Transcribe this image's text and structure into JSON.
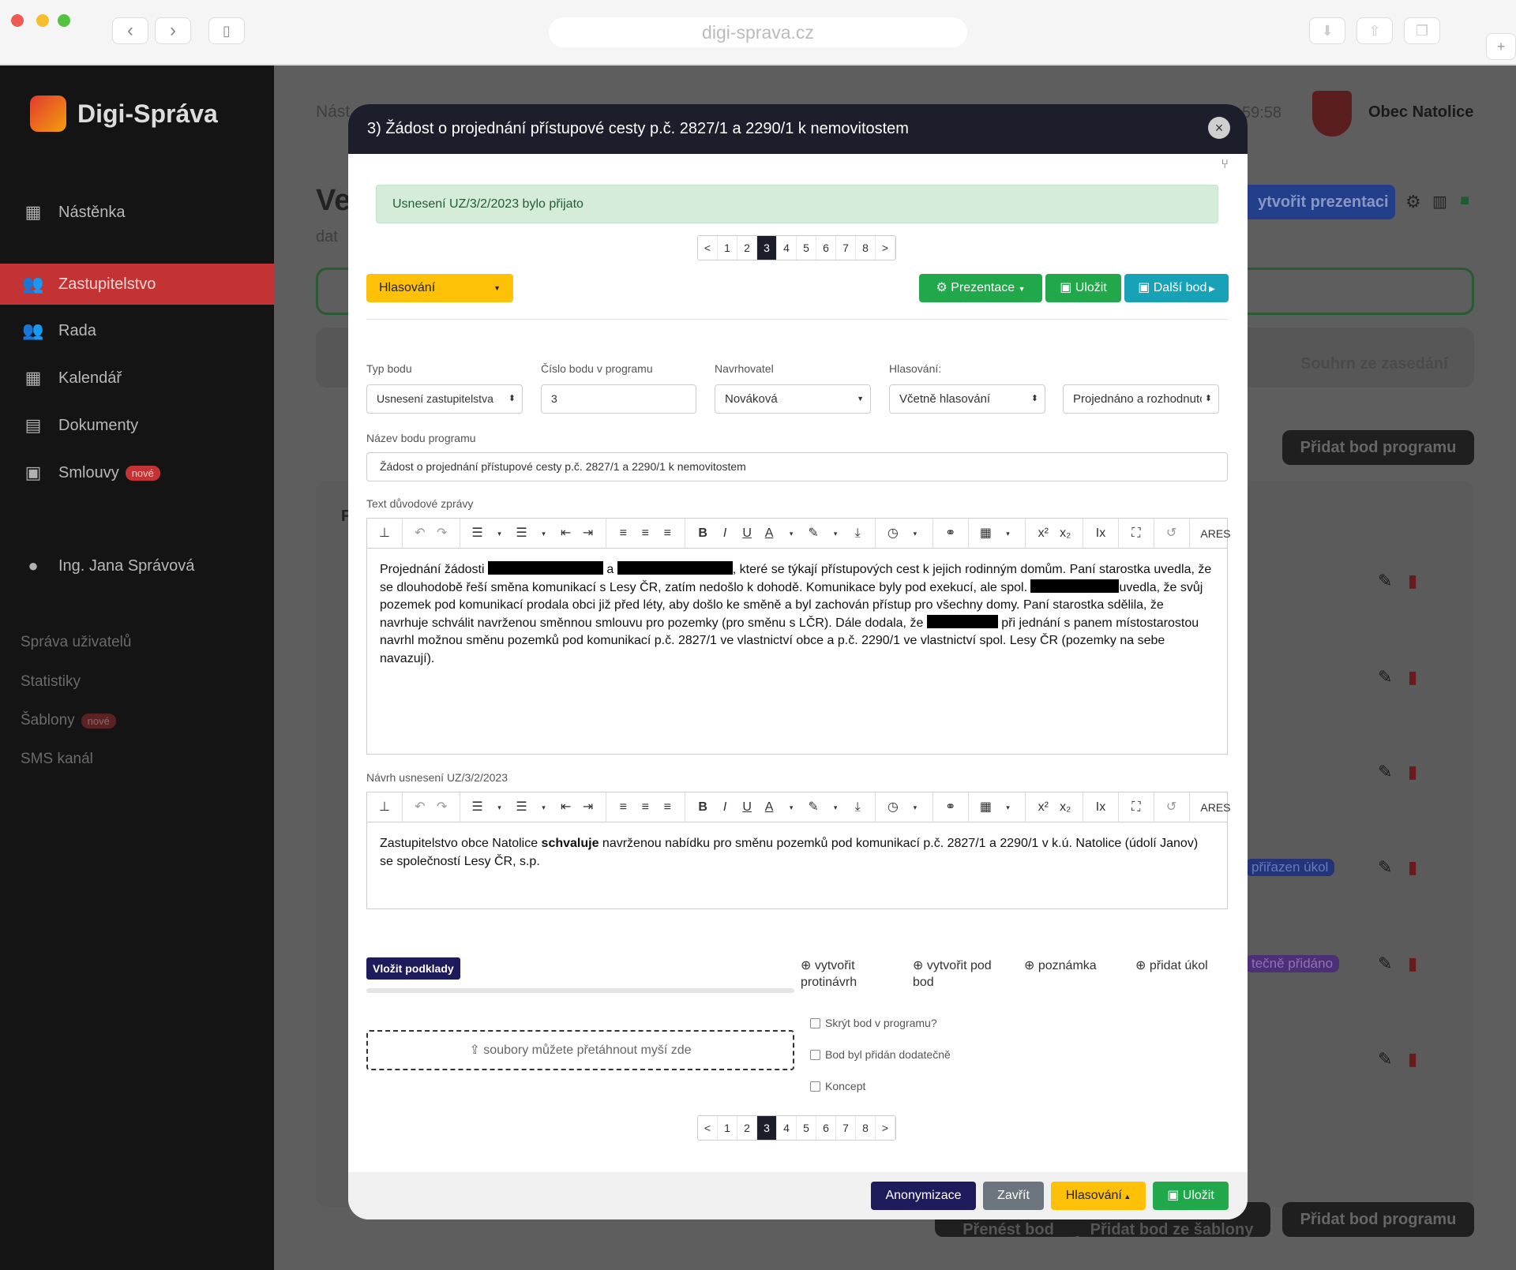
{
  "browser": {
    "url": "digi-sprava.cz"
  },
  "sidebar": {
    "logo": "Digi-Správa",
    "items": [
      {
        "label": "Nástěnka",
        "icon": "dashboard-icon"
      },
      {
        "label": "Zastupitelstvo",
        "icon": "users-icon"
      },
      {
        "label": "Rada",
        "icon": "users-icon"
      },
      {
        "label": "Kalendář",
        "icon": "calendar-icon"
      },
      {
        "label": "Dokumenty",
        "icon": "clipboard-icon"
      },
      {
        "label": "Smlouvy",
        "icon": "briefcase-icon",
        "badge": "nové"
      }
    ],
    "user": "Ing. Jana Správová",
    "admin": [
      {
        "label": "Správa uživatelů"
      },
      {
        "label": "Statistiky"
      },
      {
        "label": "Šablony",
        "badge": "nové"
      },
      {
        "label": "SMS kanál"
      }
    ]
  },
  "background": {
    "breadcrumb": "Nást",
    "time": "59:58",
    "municipality": "Obec Natolice",
    "heading": "Ve",
    "sub": "dat",
    "create_presentation": "ytvořit prezentaci",
    "summary_tab": "Souhrn ze zasedání",
    "add_item": "Přidat bod programu",
    "add_item_bottom": "Přidat bod programu",
    "move_item": "Přenést bod",
    "add_from_template": "Přidat bod ze šablony",
    "f_letter": "F",
    "tag_task": "přiřazen úkol",
    "tag_added": "tečně přidáno"
  },
  "modal": {
    "title": "3) Žádost o projednání přístupové cesty p.č. 2827/1 a 2290/1 k nemovitostem",
    "alert": "Usnesení UZ/3/2/2023 bylo přijato",
    "pager": [
      "<",
      "1",
      "2",
      "3",
      "4",
      "5",
      "6",
      "7",
      "8",
      ">"
    ],
    "pager_selected": "3",
    "voting_dropdown": "Hlasování",
    "btn_presentation": "Prezentace",
    "btn_save": "Uložit",
    "btn_next": "Další bod",
    "labels": {
      "type": "Typ bodu",
      "number": "Číslo bodu v programu",
      "proposer": "Navrhovatel",
      "voting": "Hlasování:",
      "name": "Název bodu programu",
      "reason": "Text důvodové zprávy",
      "resolution": "Návrh usnesení UZ/3/2/2023"
    },
    "values": {
      "type": "Usnesení zastupitelstva",
      "number": "3",
      "proposer": "Nováková",
      "voting": "Včetně hlasování",
      "status": "Projednáno a rozhodnuto",
      "name": "Žádost o projednání přístupové cesty p.č. 2827/1 a 2290/1 k nemovitostem"
    },
    "reason_text": {
      "p1": "Projednání žádosti ",
      "p2": " a ",
      "p3": ", které se týkají přístupových cest k jejich rodinným domům. Paní starostka uvedla, že se dlouhodobě řeší směna komunikací s Lesy ČR, zatím nedošlo k dohodě. Komunikace byly pod exekucí, ale spol. ",
      "p4": "uvedla, že svůj pozemek pod komunikací prodala obci již před léty, aby došlo ke směně a byl zachován přístup pro všechny domy. Paní starostka sdělila, že navrhuje schválit navrženou směnnou smlouvu pro pozemky (pro směnu s LČR). Dále dodala, že ",
      "p5": " při jednání s panem místostarostou navrhl možnou směnu pozemků pod komunikací p.č. 2827/1 ve vlastnictví obce a p.č. 2290/1 ve vlastnictví spol. Lesy ČR (pozemky na sebe navazují)."
    },
    "resolution_text": {
      "a": "Zastupitelstvo obce Natolice ",
      "b": "schvaluje",
      "c": " navrženou nabídku pro směnu pozemků pod komunikací p.č. 2827/1 a 2290/1 v k.ú. Natolice (údolí Janov) se společností Lesy ČR, s.p."
    },
    "toolbar_ares": "ARES",
    "upload_btn": "Vložit podklady",
    "dropzone": "soubory můžete přetáhnout myší zde",
    "actions": [
      {
        "label": "vytvořit protinávrh"
      },
      {
        "label": "vytvořit pod bod"
      },
      {
        "label": "poznámka"
      },
      {
        "label": "přidat úkol"
      }
    ],
    "checkboxes": [
      {
        "label": "Skrýt bod v programu?"
      },
      {
        "label": "Bod byl přidán dodatečně"
      },
      {
        "label": "Koncept"
      }
    ],
    "footer": {
      "anonymize": "Anonymizace",
      "close": "Zavřít",
      "voting": "Hlasování",
      "save": "Uložit"
    }
  },
  "colors": {
    "accent_red": "#c43333",
    "navy": "#1c1f2b",
    "green": "#21a84a",
    "cyan": "#17a2b8",
    "yellow": "#ffc107",
    "purple_btn": "#1e1b5c"
  }
}
